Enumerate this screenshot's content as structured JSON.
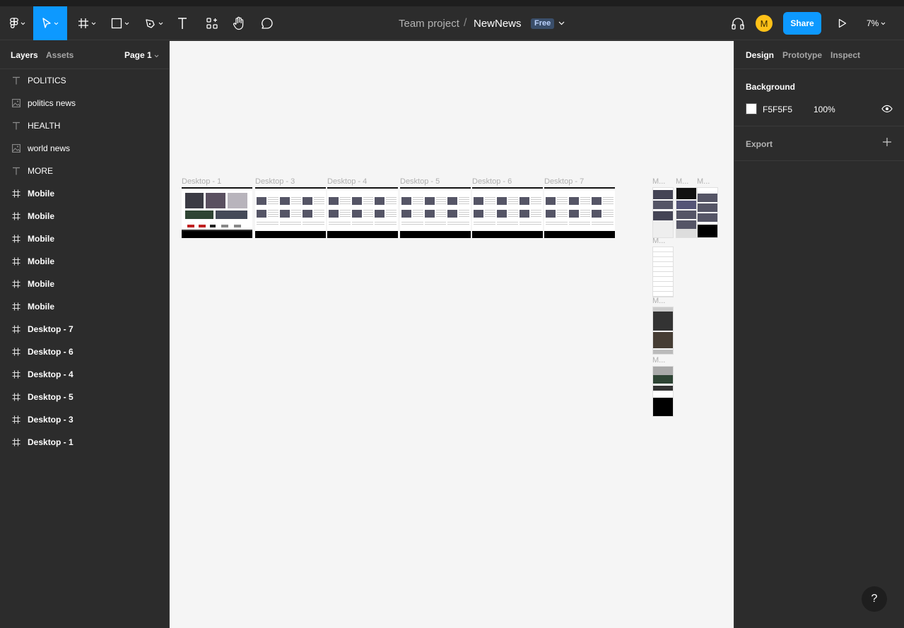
{
  "toolbar": {
    "team": "Team project",
    "separator": "/",
    "file_name": "NewNews",
    "plan_badge": "Free",
    "avatar_initial": "M",
    "share_label": "Share",
    "zoom": "7%"
  },
  "left_panel": {
    "tab_layers": "Layers",
    "tab_assets": "Assets",
    "page": "Page 1",
    "layers": [
      {
        "label": "POLITICS",
        "type": "text"
      },
      {
        "label": "politics news",
        "type": "image"
      },
      {
        "label": "HEALTH",
        "type": "text"
      },
      {
        "label": "world news",
        "type": "image"
      },
      {
        "label": "MORE",
        "type": "text"
      },
      {
        "label": "Mobile",
        "type": "frame"
      },
      {
        "label": "Mobile",
        "type": "frame"
      },
      {
        "label": "Mobile",
        "type": "frame"
      },
      {
        "label": "Mobile",
        "type": "frame"
      },
      {
        "label": "Mobile",
        "type": "frame"
      },
      {
        "label": "Mobile",
        "type": "frame"
      },
      {
        "label": "Desktop - 7",
        "type": "frame"
      },
      {
        "label": "Desktop - 6",
        "type": "frame"
      },
      {
        "label": "Desktop - 4",
        "type": "frame"
      },
      {
        "label": "Desktop - 5",
        "type": "frame"
      },
      {
        "label": "Desktop - 3",
        "type": "frame"
      },
      {
        "label": "Desktop - 1",
        "type": "frame"
      }
    ]
  },
  "canvas": {
    "background": "#f5f5f5",
    "desktop_frames": [
      "Desktop - 1",
      "Desktop - 3",
      "Desktop - 4",
      "Desktop - 5",
      "Desktop - 6",
      "Desktop - 7"
    ],
    "mobile_labels": [
      "M...",
      "M...",
      "M...",
      "M...",
      "M...",
      "M..."
    ]
  },
  "right_panel": {
    "tab_design": "Design",
    "tab_prototype": "Prototype",
    "tab_inspect": "Inspect",
    "background_title": "Background",
    "background_hex": "F5F5F5",
    "background_opacity": "100%",
    "export_title": "Export"
  },
  "help_label": "?",
  "colors": {
    "accent": "#0d99ff",
    "panel": "#2c2c2c",
    "avatar": "#ffc118"
  }
}
